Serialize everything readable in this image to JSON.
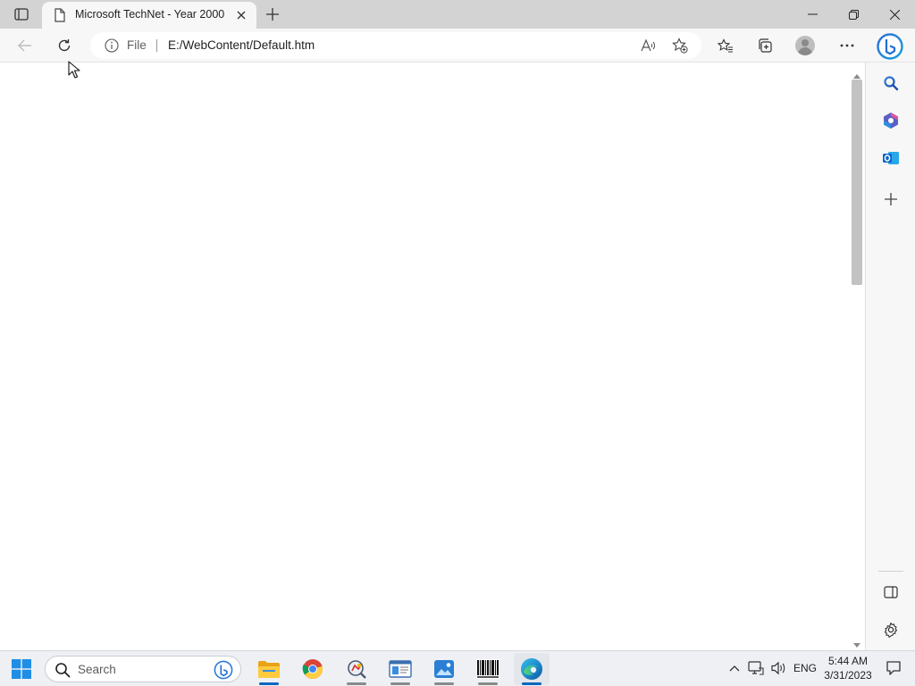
{
  "browser": {
    "tab": {
      "title": "Microsoft TechNet - Year 2000"
    },
    "address_bar": {
      "scheme_label": "File",
      "url": "E:/WebContent/Default.htm"
    }
  },
  "taskbar": {
    "search_placeholder": "Search",
    "tray": {
      "language": "ENG"
    },
    "clock": {
      "time": "5:44 AM",
      "date": "3/31/2023"
    }
  }
}
